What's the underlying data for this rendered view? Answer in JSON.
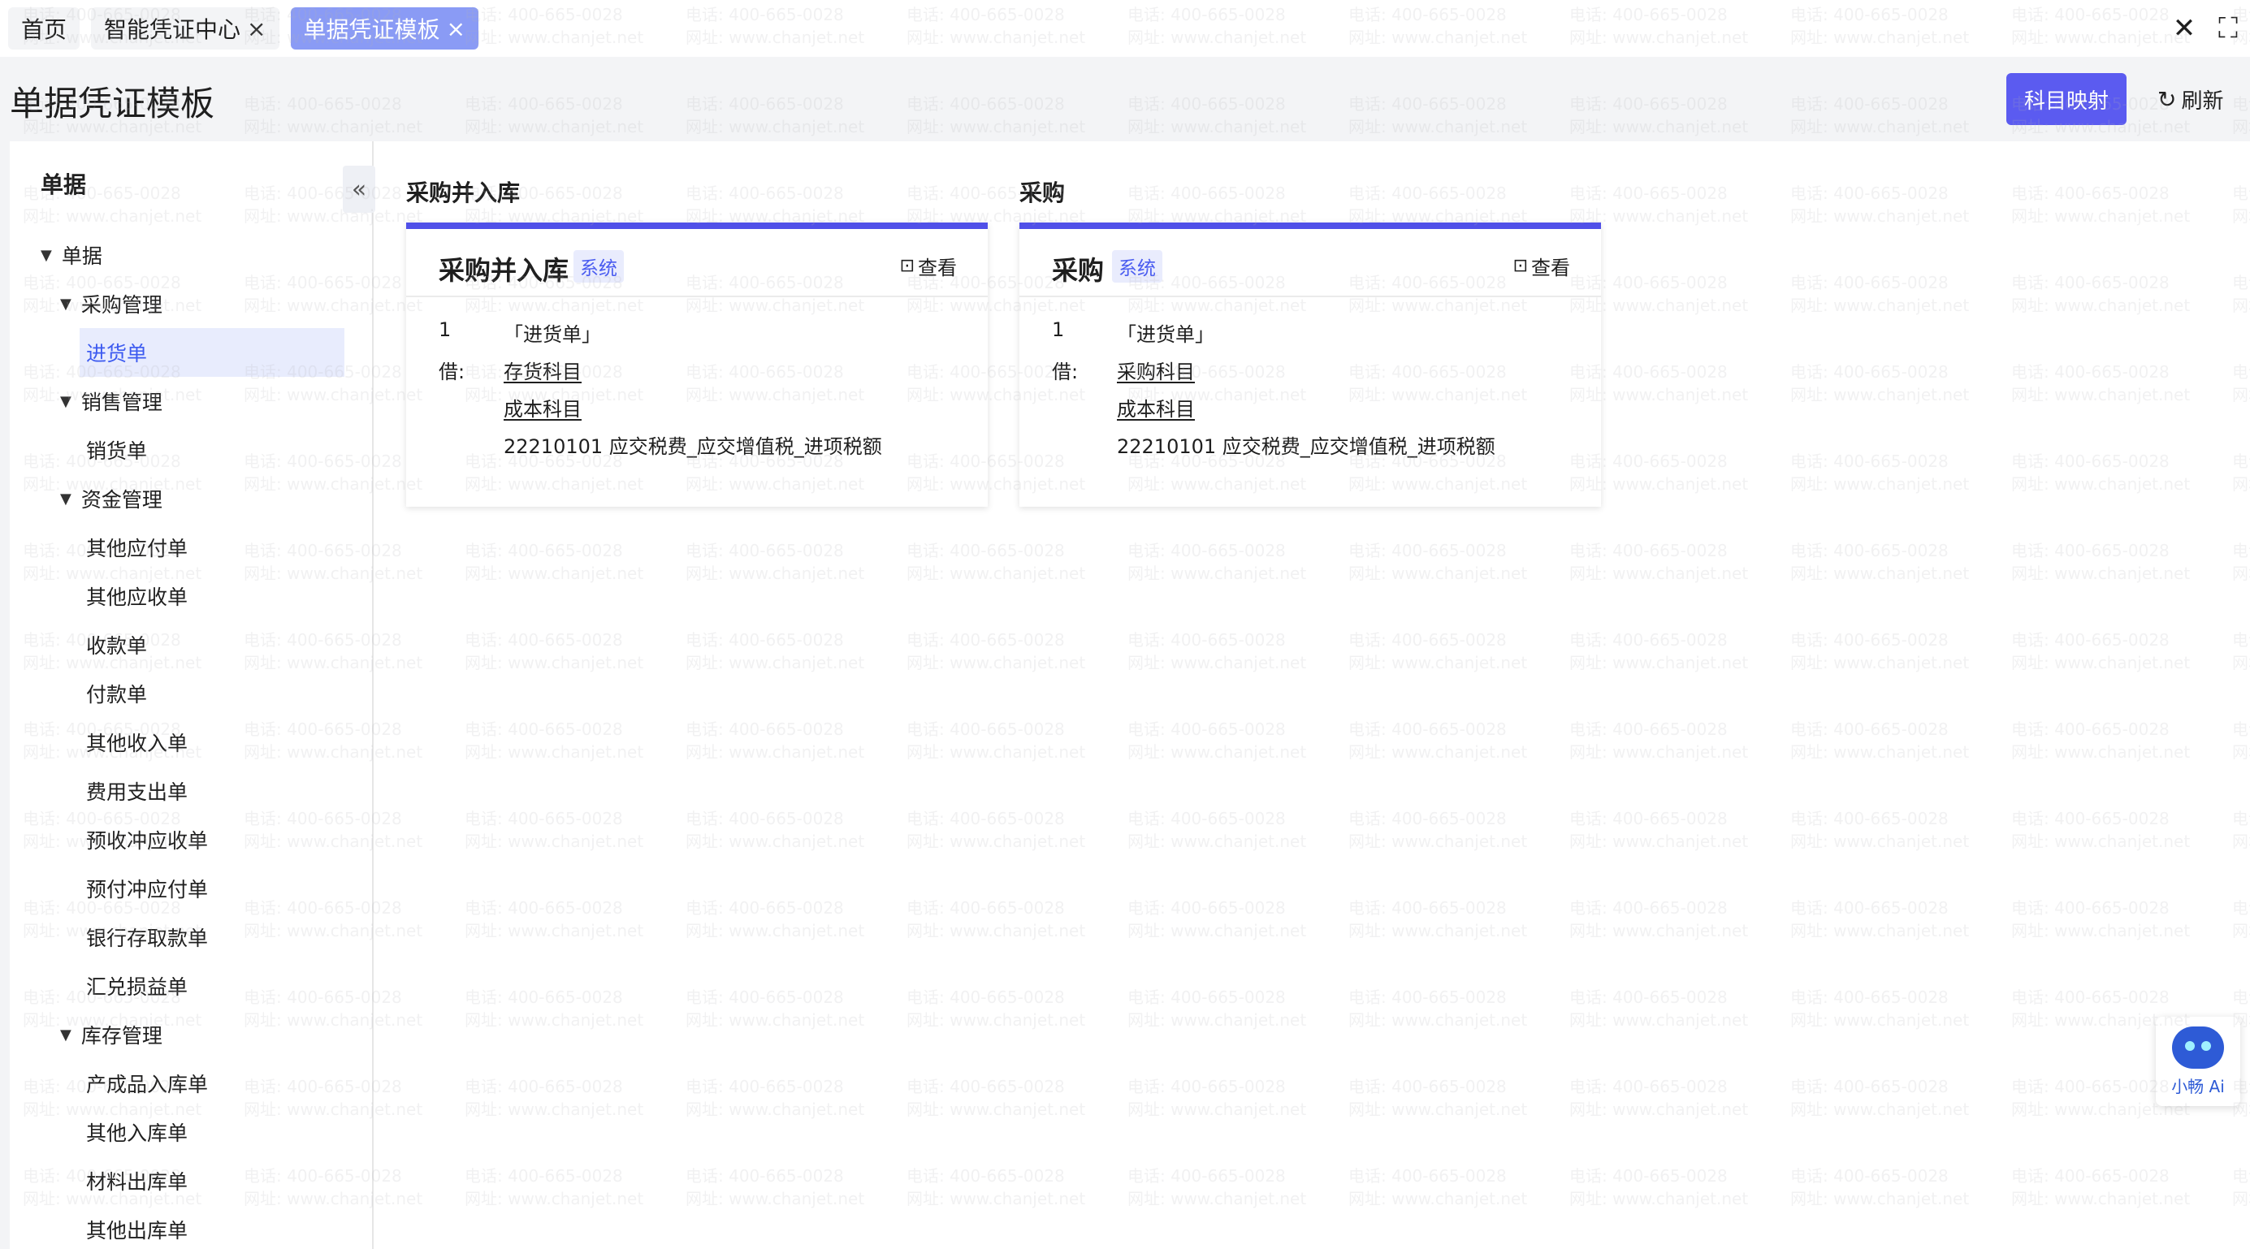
{
  "tabs": [
    {
      "label": "首页",
      "closable": false,
      "active": false
    },
    {
      "label": "智能凭证中心",
      "closable": true,
      "active": false
    },
    {
      "label": "单据凭证模板",
      "closable": true,
      "active": true
    }
  ],
  "window_icons": {
    "close": "close-icon",
    "fullscreen": "expand-icon"
  },
  "header": {
    "title": "单据凭证模板",
    "primary_button": "科目映射",
    "refresh_button": "刷新"
  },
  "sidebar": {
    "heading": "单据",
    "collapse_icon": "double-chevron-left-icon",
    "tree": [
      {
        "label": "单据",
        "level": 0,
        "expanded": true
      },
      {
        "label": "采购管理",
        "level": 1,
        "expanded": true
      },
      {
        "label": "进货单",
        "level": 2,
        "selected": true
      },
      {
        "label": "销售管理",
        "level": 1,
        "expanded": true
      },
      {
        "label": "销货单",
        "level": 2
      },
      {
        "label": "资金管理",
        "level": 1,
        "expanded": true
      },
      {
        "label": "其他应付单",
        "level": 2
      },
      {
        "label": "其他应收单",
        "level": 2
      },
      {
        "label": "收款单",
        "level": 2
      },
      {
        "label": "付款单",
        "level": 2
      },
      {
        "label": "其他收入单",
        "level": 2
      },
      {
        "label": "费用支出单",
        "level": 2
      },
      {
        "label": "预收冲应收单",
        "level": 2
      },
      {
        "label": "预付冲应付单",
        "level": 2
      },
      {
        "label": "银行存取款单",
        "level": 2
      },
      {
        "label": "汇兑损益单",
        "level": 2
      },
      {
        "label": "库存管理",
        "level": 1,
        "expanded": true
      },
      {
        "label": "产成品入库单",
        "level": 2
      },
      {
        "label": "其他入库单",
        "level": 2
      },
      {
        "label": "材料出库单",
        "level": 2
      },
      {
        "label": "其他出库单",
        "level": 2
      }
    ]
  },
  "groups": [
    {
      "group_title": "采购并入库",
      "card": {
        "title": "采购并入库",
        "badge": "系统",
        "view_label": "查看",
        "row_number": "1",
        "doc_name": "「进货单」",
        "debit_label": "借:",
        "accounts": [
          "存货科目",
          "成本科目"
        ],
        "tax_line": "22210101 应交税费_应交增值税_进项税额"
      }
    },
    {
      "group_title": "采购",
      "card": {
        "title": "采购",
        "badge": "系统",
        "view_label": "查看",
        "row_number": "1",
        "doc_name": "「进货单」",
        "debit_label": "借:",
        "accounts": [
          "采购科目",
          "成本科目"
        ],
        "tax_line": "22210101 应交税费_应交增值税_进项税额"
      }
    }
  ],
  "watermark": {
    "line1": "电话: 400-665-0028",
    "line2": "网址: www.chanjet.net"
  },
  "ai_widget": {
    "label": "小畅 Ai",
    "icon": "robot-icon"
  },
  "colors": {
    "accent": "#5b5bf0",
    "active_tab": "#8a9bf5",
    "card_border": "#5050e8",
    "badge_bg": "#e9ecfd"
  }
}
